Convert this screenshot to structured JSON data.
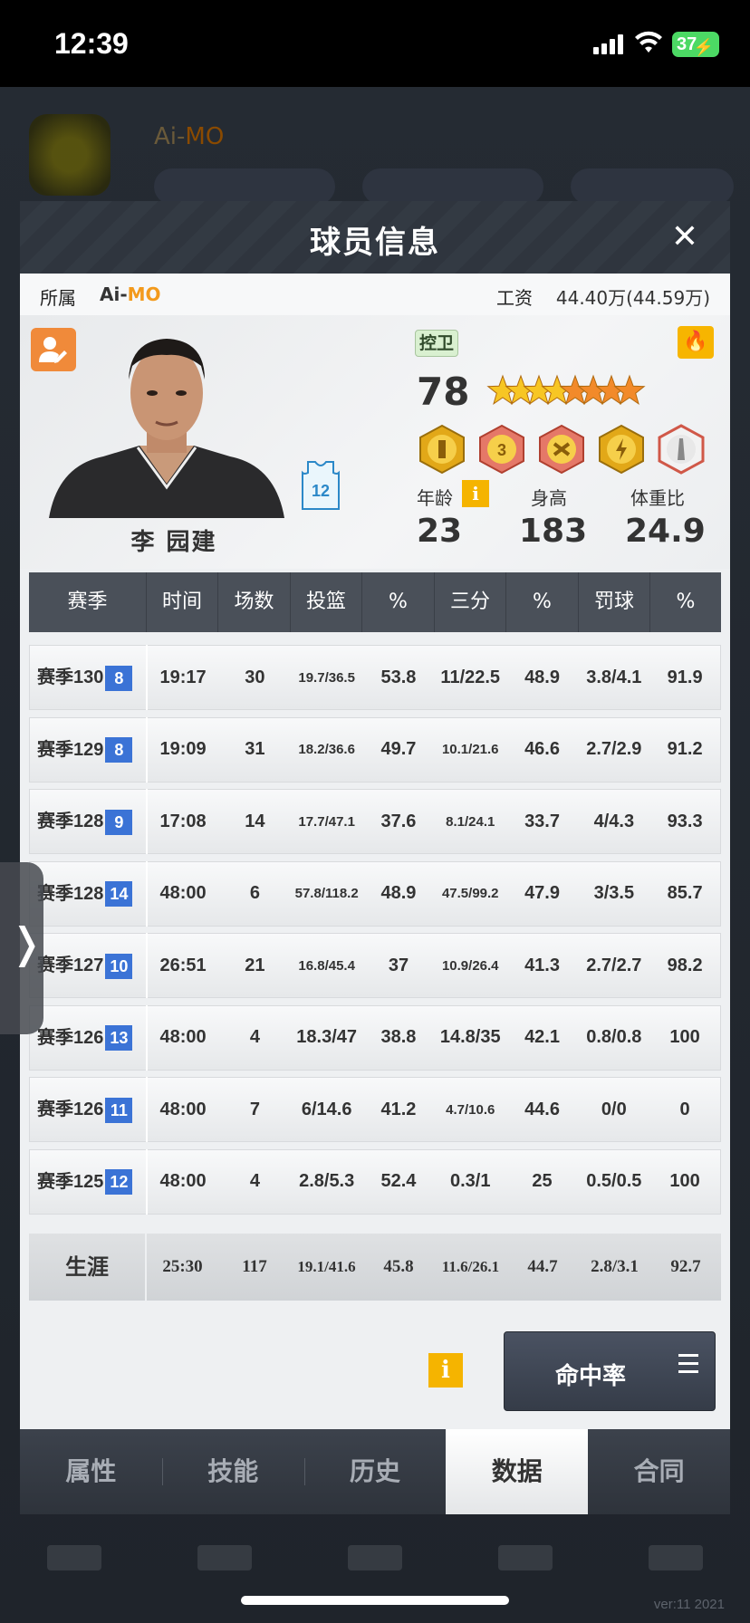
{
  "status_bar": {
    "time": "12:39",
    "battery": "37"
  },
  "background": {
    "team_prefix": "Ai-",
    "team_suffix": "MO",
    "version": "ver:11   2021"
  },
  "modal": {
    "title": "球员信息",
    "close_icon": "close-icon",
    "team": {
      "label": "所属",
      "name_prefix": "Ai-",
      "name_suffix": "MO",
      "accent_color": "#f39a1c"
    },
    "salary": {
      "label": "工资",
      "value": "44.40万(44.59万)"
    }
  },
  "player": {
    "name": "李 园建",
    "position": "控卫",
    "rating": "78",
    "jersey_number": "12",
    "star_count": 8,
    "attributes": [
      {
        "label": "年龄",
        "value": "23"
      },
      {
        "label": "身高",
        "value": "183"
      },
      {
        "label": "体重比",
        "value": "24.9"
      }
    ]
  },
  "table": {
    "headers": [
      "赛季",
      "时间",
      "场数",
      "投篮",
      "%",
      "三分",
      "%",
      "罚球",
      "%"
    ],
    "rows": [
      {
        "season": "赛季130",
        "badge": "8",
        "time": "19:17",
        "games": "30",
        "fg": "19.7/36.5",
        "fg_pct": "53.8",
        "three": "11/22.5",
        "three_pct": "48.9",
        "ft": "3.8/4.1",
        "ft_pct": "91.9"
      },
      {
        "season": "赛季129",
        "badge": "8",
        "time": "19:09",
        "games": "31",
        "fg": "18.2/36.6",
        "fg_pct": "49.7",
        "three": "10.1/21.6",
        "three_pct": "46.6",
        "ft": "2.7/2.9",
        "ft_pct": "91.2"
      },
      {
        "season": "赛季128",
        "badge": "9",
        "time": "17:08",
        "games": "14",
        "fg": "17.7/47.1",
        "fg_pct": "37.6",
        "three": "8.1/24.1",
        "three_pct": "33.7",
        "ft": "4/4.3",
        "ft_pct": "93.3"
      },
      {
        "season": "赛季128",
        "badge": "14",
        "time": "48:00",
        "games": "6",
        "fg": "57.8/118.2",
        "fg_pct": "48.9",
        "three": "47.5/99.2",
        "three_pct": "47.9",
        "ft": "3/3.5",
        "ft_pct": "85.7"
      },
      {
        "season": "赛季127",
        "badge": "10",
        "time": "26:51",
        "games": "21",
        "fg": "16.8/45.4",
        "fg_pct": "37",
        "three": "10.9/26.4",
        "three_pct": "41.3",
        "ft": "2.7/2.7",
        "ft_pct": "98.2"
      },
      {
        "season": "赛季126",
        "badge": "13",
        "time": "48:00",
        "games": "4",
        "fg": "18.3/47",
        "fg_pct": "38.8",
        "three": "14.8/35",
        "three_pct": "42.1",
        "ft": "0.8/0.8",
        "ft_pct": "100"
      },
      {
        "season": "赛季126",
        "badge": "11",
        "time": "48:00",
        "games": "7",
        "fg": "6/14.6",
        "fg_pct": "41.2",
        "three": "4.7/10.6",
        "three_pct": "44.6",
        "ft": "0/0",
        "ft_pct": "0"
      },
      {
        "season": "赛季125",
        "badge": "12",
        "time": "48:00",
        "games": "4",
        "fg": "2.8/5.3",
        "fg_pct": "52.4",
        "three": "0.3/1",
        "three_pct": "25",
        "ft": "0.5/0.5",
        "ft_pct": "100"
      }
    ],
    "career": {
      "label": "生涯",
      "time": "25:30",
      "games": "117",
      "fg": "19.1/41.6",
      "fg_pct": "45.8",
      "three": "11.6/26.1",
      "three_pct": "44.7",
      "ft": "2.8/3.1",
      "ft_pct": "92.7"
    }
  },
  "footer": {
    "info_icon": "i",
    "accuracy_button": "命中率"
  },
  "tabs": [
    {
      "label": "属性",
      "active": false
    },
    {
      "label": "技能",
      "active": false
    },
    {
      "label": "历史",
      "active": false
    },
    {
      "label": "数据",
      "active": true
    },
    {
      "label": "合同",
      "active": false
    }
  ],
  "colors": {
    "badge_blue": "#3b73d6",
    "gold": "#f5b400",
    "header_dark": "#4a5059"
  }
}
